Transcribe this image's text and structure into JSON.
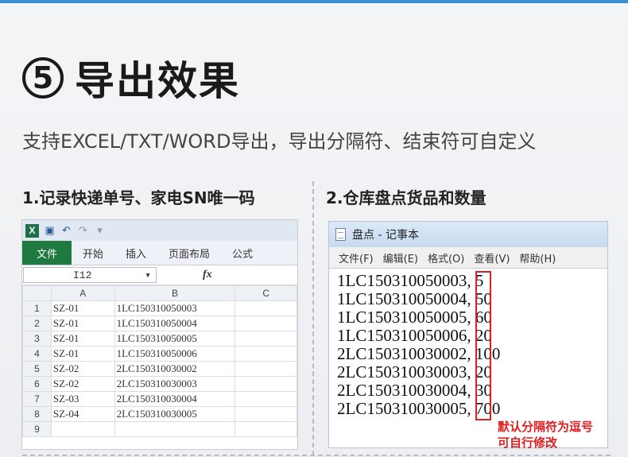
{
  "header": {
    "step_number": "5",
    "title": "导出效果",
    "subtitle": "支持EXCEL/TXT/WORD导出，导出分隔符、结束符可自定义"
  },
  "section1": {
    "label": "1.记录快递单号、家电SN唯一码"
  },
  "section2": {
    "label": "2.仓库盘点货品和数量"
  },
  "excel": {
    "file_tab": "文件",
    "tabs": [
      "开始",
      "插入",
      "页面布局",
      "公式"
    ],
    "name_box": "I12",
    "fx": "fx",
    "columns": [
      "A",
      "B",
      "C"
    ],
    "rows": [
      {
        "num": "1",
        "a": "SZ-01",
        "b": "1LC150310050003"
      },
      {
        "num": "2",
        "a": "SZ-01",
        "b": "1LC150310050004"
      },
      {
        "num": "3",
        "a": "SZ-01",
        "b": "1LC150310050005"
      },
      {
        "num": "4",
        "a": "SZ-01",
        "b": "1LC150310050006"
      },
      {
        "num": "5",
        "a": "SZ-02",
        "b": "2LC150310030002"
      },
      {
        "num": "6",
        "a": "SZ-02",
        "b": "2LC150310030003"
      },
      {
        "num": "7",
        "a": "SZ-03",
        "b": "2LC150310030004"
      },
      {
        "num": "8",
        "a": "SZ-04",
        "b": "2LC150310030005"
      },
      {
        "num": "9",
        "a": "",
        "b": ""
      }
    ]
  },
  "notepad": {
    "title": "盘点 - 记事本",
    "menu": [
      "文件(F)",
      "编辑(E)",
      "格式(O)",
      "查看(V)",
      "帮助(H)"
    ],
    "lines": [
      "1LC150310050003, 5",
      "1LC150310050004, 50",
      "1LC150310050005, 60",
      "1LC150310050006, 20",
      "2LC150310030002, 100",
      "2LC150310030003, 20",
      "2LC150310030004, 30",
      "2LC150310030005, 700"
    ],
    "annotation_line1": "默认分隔符为逗号",
    "annotation_line2": "可自行修改",
    "annotation_color": "#e02020"
  }
}
